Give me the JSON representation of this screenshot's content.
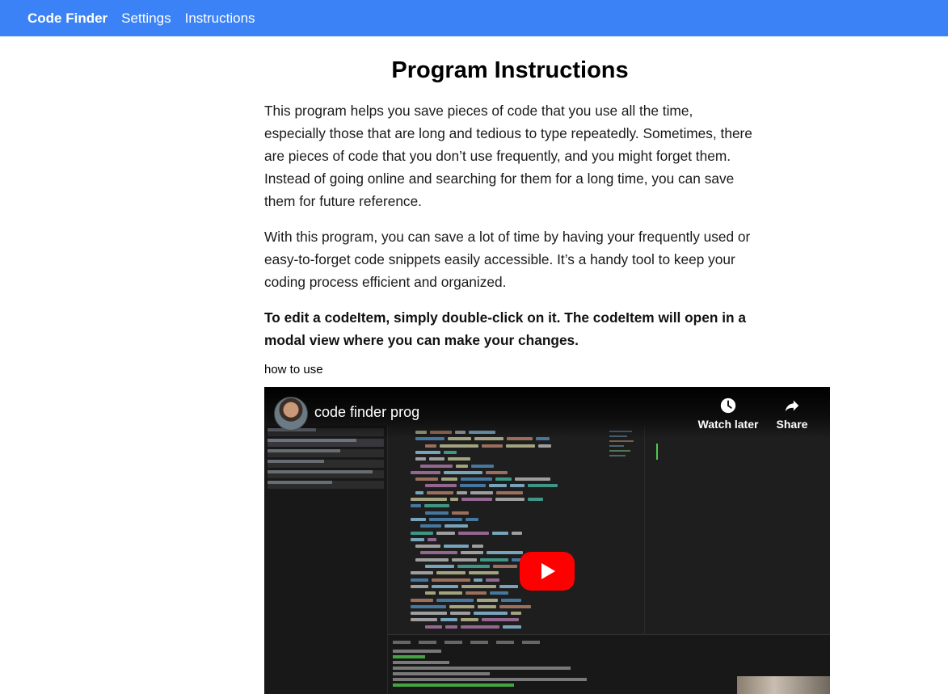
{
  "nav": {
    "brand": "Code Finder",
    "links": [
      "Settings",
      "Instructions"
    ],
    "background_color": "#3b82f6"
  },
  "page": {
    "title": "Program Instructions",
    "paragraphs": [
      "This program helps you save pieces of code that you use all the time, especially those that are long and tedious to type repeatedly. Sometimes, there are pieces of code that you don’t use frequently, and you might forget them. Instead of going online and searching for them for a long time, you can save them for future reference.",
      "With this program, you can save a lot of time by having your frequently used or easy-to-forget code snippets easily accessible. It’s a handy tool to keep your coding process efficient and organized.",
      "To edit a codeItem, simply double-click on it. The codeItem will open in a modal view where you can make your changes."
    ],
    "video_label": "how to use"
  },
  "video": {
    "title": "code finder prog",
    "watch_later_label": "Watch later",
    "share_label": "Share",
    "play_button_color": "#ff0000",
    "watch_later_icon": "clock-icon",
    "share_icon": "share-arrow-icon"
  }
}
